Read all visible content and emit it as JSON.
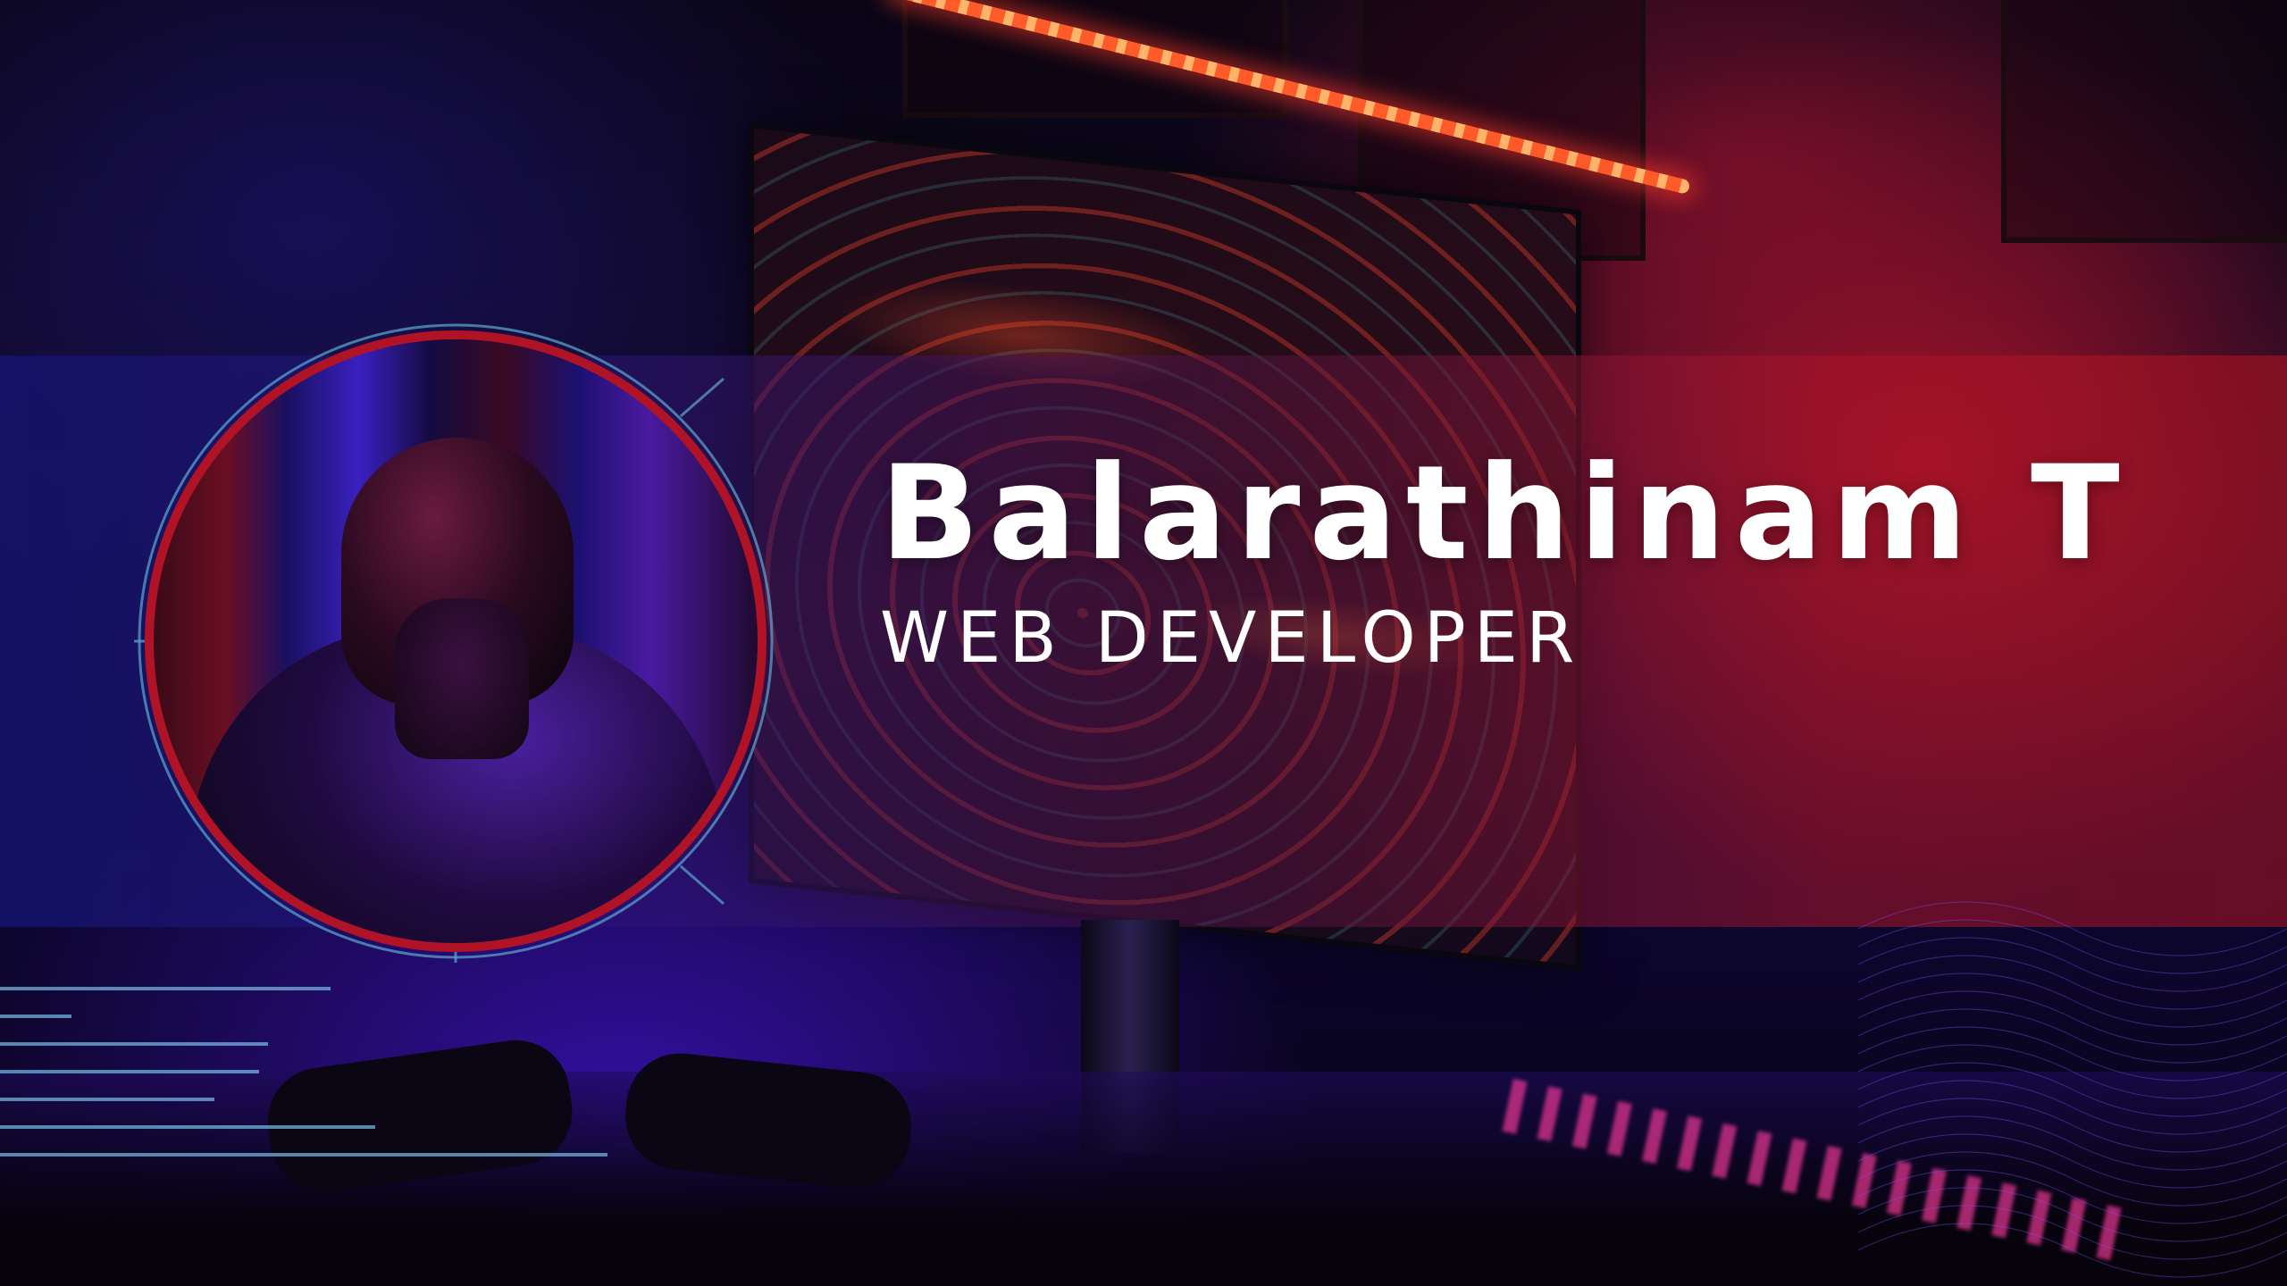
{
  "profile": {
    "name": "Balarathinam T",
    "role": "WEB DEVELOPER"
  },
  "colors": {
    "accent_red": "#b01226",
    "accent_blue": "#5aa0c8",
    "text": "#ffffff"
  },
  "icons": {
    "avatar": "hooded-figure-portrait"
  }
}
